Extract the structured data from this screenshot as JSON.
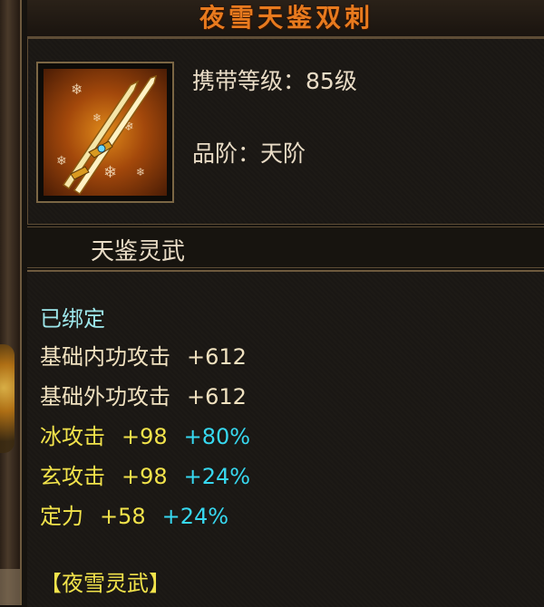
{
  "item": {
    "title": "夜雪天鉴双刺",
    "level_label": "携带等级：",
    "level_value": "85级",
    "grade_label": "品阶：",
    "grade_value": "天阶",
    "name": "天鉴灵武",
    "icon": "golden-dual-blades-icon"
  },
  "stats": {
    "bound": "已绑定",
    "lines": [
      {
        "name": "基础内功攻击",
        "value": "+612"
      },
      {
        "name": "基础外功攻击",
        "value": "+612"
      },
      {
        "name": "冰攻击",
        "value": "+98",
        "bonus": "+80%"
      },
      {
        "name": "玄攻击",
        "value": "+98",
        "bonus": "+24%"
      },
      {
        "name": "定力",
        "value": "+58",
        "bonus": "+24%"
      }
    ],
    "set_name": "【夜雪灵武】"
  },
  "colors": {
    "title": "#e87a1e",
    "bound": "#9ee8ec",
    "yellow": "#f2e34b",
    "cyan": "#37d8f0"
  }
}
